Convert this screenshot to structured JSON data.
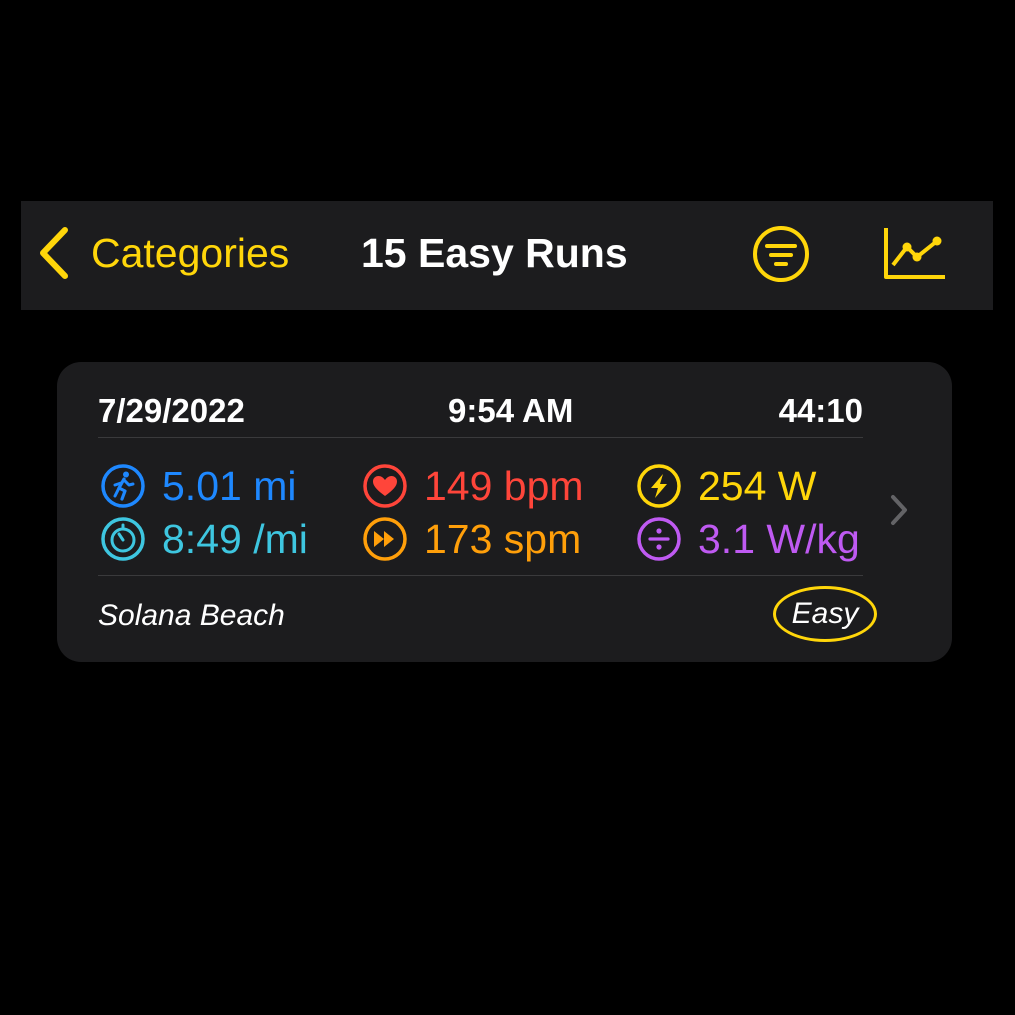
{
  "navbar": {
    "back_label": "Categories",
    "title": "15 Easy Runs",
    "back_icon": "chevron-left-icon",
    "filter_icon": "filter-circle-icon",
    "chart_icon": "line-chart-icon",
    "accent_color": "#ffd60a"
  },
  "workout": {
    "date": "7/29/2022",
    "time": "9:54 AM",
    "duration": "44:10",
    "metrics": {
      "distance": {
        "value": "5.01 mi",
        "icon": "running-figure-icon",
        "color": "#1e88ff"
      },
      "pace": {
        "value": "8:49 /mi",
        "icon": "stopwatch-icon",
        "color": "#3ec6e0"
      },
      "heart_rate": {
        "value": "149 bpm",
        "icon": "heart-icon",
        "color": "#ff453a"
      },
      "cadence": {
        "value": "173 spm",
        "icon": "fast-forward-icon",
        "color": "#ff9f0a"
      },
      "power": {
        "value": "254 W",
        "icon": "bolt-icon",
        "color": "#ffd60a"
      },
      "power_to_weight": {
        "value": "3.1 W/kg",
        "icon": "divide-icon",
        "color": "#bf5af2"
      }
    },
    "location": "Solana Beach",
    "category": "Easy",
    "disclosure_icon": "chevron-right-icon"
  }
}
